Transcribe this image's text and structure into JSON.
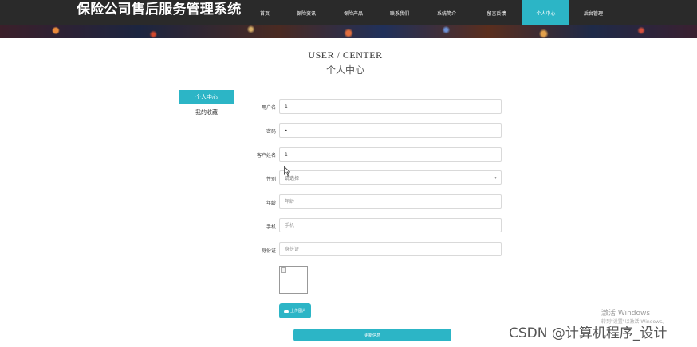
{
  "header": {
    "title": "保险公司售后服务管理系统",
    "nav": [
      {
        "label": "首页",
        "active": false
      },
      {
        "label": "保险资讯",
        "active": false
      },
      {
        "label": "保险产品",
        "active": false
      },
      {
        "label": "联系我们",
        "active": false
      },
      {
        "label": "系统简介",
        "active": false
      },
      {
        "label": "留言反馈",
        "active": false
      },
      {
        "label": "个人中心",
        "active": true
      },
      {
        "label": "后台管理",
        "active": false
      }
    ]
  },
  "page": {
    "title_en": "USER / CENTER",
    "title_cn": "个人中心"
  },
  "sidebar": {
    "items": [
      {
        "label": "个人中心",
        "active": true
      },
      {
        "label": "我的收藏",
        "active": false
      }
    ]
  },
  "form": {
    "username": {
      "label": "用户名",
      "value": "1"
    },
    "password": {
      "label": "密码",
      "value": "•"
    },
    "customer_name": {
      "label": "客户姓名",
      "value": "1"
    },
    "gender": {
      "label": "性别",
      "selected": "请选择"
    },
    "age": {
      "label": "年龄",
      "placeholder": "年龄"
    },
    "phone": {
      "label": "手机",
      "placeholder": "手机"
    },
    "id_card": {
      "label": "身份证",
      "placeholder": "身份证"
    },
    "upload_label": "上传图片",
    "submit_label": "更新信息"
  },
  "overlay": {
    "activate_title": "激活 Windows",
    "activate_sub": "转到\"设置\"以激活 Windows。",
    "watermark": "CSDN @计算机程序_设计"
  },
  "colors": {
    "accent": "#2cb5c6",
    "header_bg": "#2a2a2a"
  }
}
